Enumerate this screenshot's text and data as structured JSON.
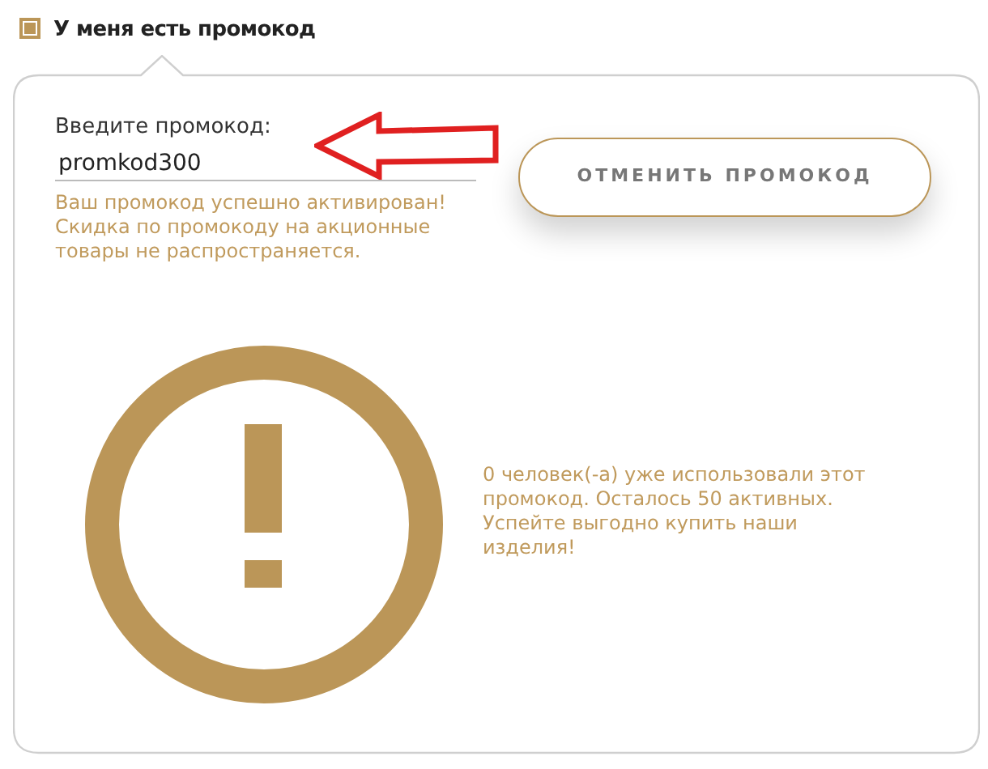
{
  "promo_toggle": {
    "label": "У меня есть промокод",
    "checked": true
  },
  "promo_form": {
    "label": "Введите промокод:",
    "value": "promkod300",
    "message": "Ваш промокод успешно активирован! Скидка по промокоду на акционные товары не распространяется.",
    "cancel_button": "ОТМЕНИТЬ ПРОМОКОД"
  },
  "usage_info": [
    "0 человек(-а) уже использовали этот промокод. Осталось 50 активных.",
    "Успейте выгодно купить наши изделия!"
  ]
}
